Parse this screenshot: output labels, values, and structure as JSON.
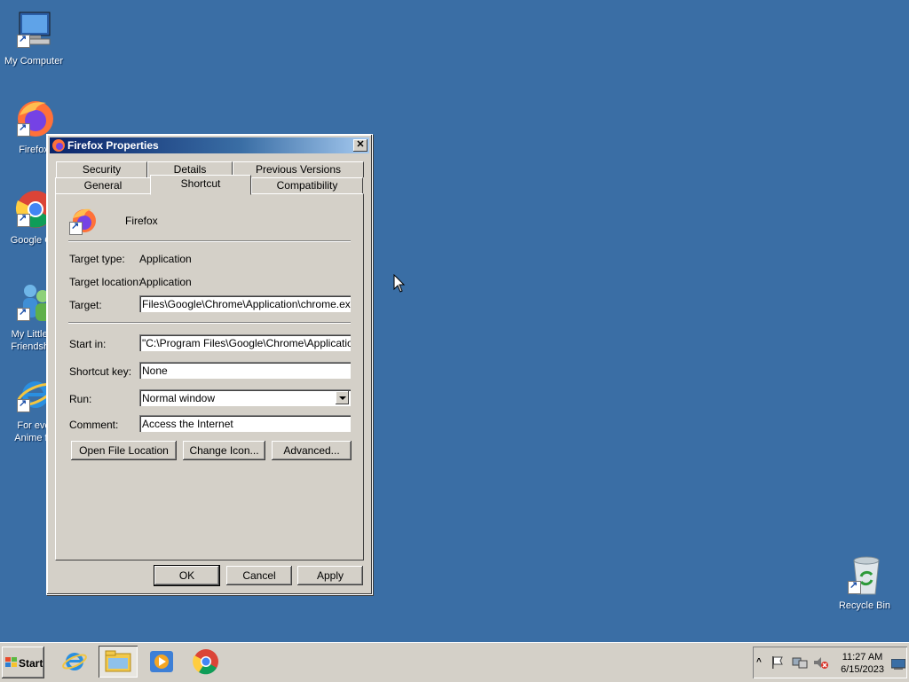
{
  "desktop": {
    "icons": [
      {
        "label": "My Computer",
        "icon": "my-computer-icon"
      },
      {
        "label": "Firefox",
        "icon": "firefox-icon"
      },
      {
        "label": "Google Ch",
        "icon": "chrome-icon"
      },
      {
        "label": "My Little F\nFriendship",
        "icon": "people-icon"
      },
      {
        "label": "For eve\nAnime fa",
        "icon": "internet-explorer-icon"
      },
      {
        "label": "Recycle Bin",
        "icon": "recycle-bin-icon"
      }
    ]
  },
  "dialog": {
    "title": "Firefox Properties",
    "close_label": "✕",
    "tabs_row1": [
      "Security",
      "Details",
      "Previous Versions"
    ],
    "tabs_row2": [
      "General",
      "Shortcut",
      "Compatibility"
    ],
    "active_tab": "Shortcut",
    "app_name": "Firefox",
    "fields": {
      "target_type_label": "Target type:",
      "target_type_value": "Application",
      "target_location_label": "Target location:",
      "target_location_value": "Application",
      "target_label": "Target:",
      "target_value": "Files\\Google\\Chrome\\Application\\chrome.exe\" --",
      "start_in_label": "Start in:",
      "start_in_value": "\"C:\\Program Files\\Google\\Chrome\\Application\"",
      "shortcut_key_label": "Shortcut key:",
      "shortcut_key_value": "None",
      "run_label": "Run:",
      "run_value": "Normal window",
      "comment_label": "Comment:",
      "comment_value": "Access the Internet"
    },
    "buttons": {
      "open_file_location": "Open File Location",
      "change_icon": "Change Icon...",
      "advanced": "Advanced...",
      "ok": "OK",
      "cancel": "Cancel",
      "apply": "Apply"
    }
  },
  "taskbar": {
    "start_label": "Start",
    "apps": [
      "internet-explorer-icon",
      "file-explorer-icon",
      "media-player-icon",
      "chrome-icon"
    ],
    "clock_time": "11:27 AM",
    "clock_date": "6/15/2023"
  }
}
